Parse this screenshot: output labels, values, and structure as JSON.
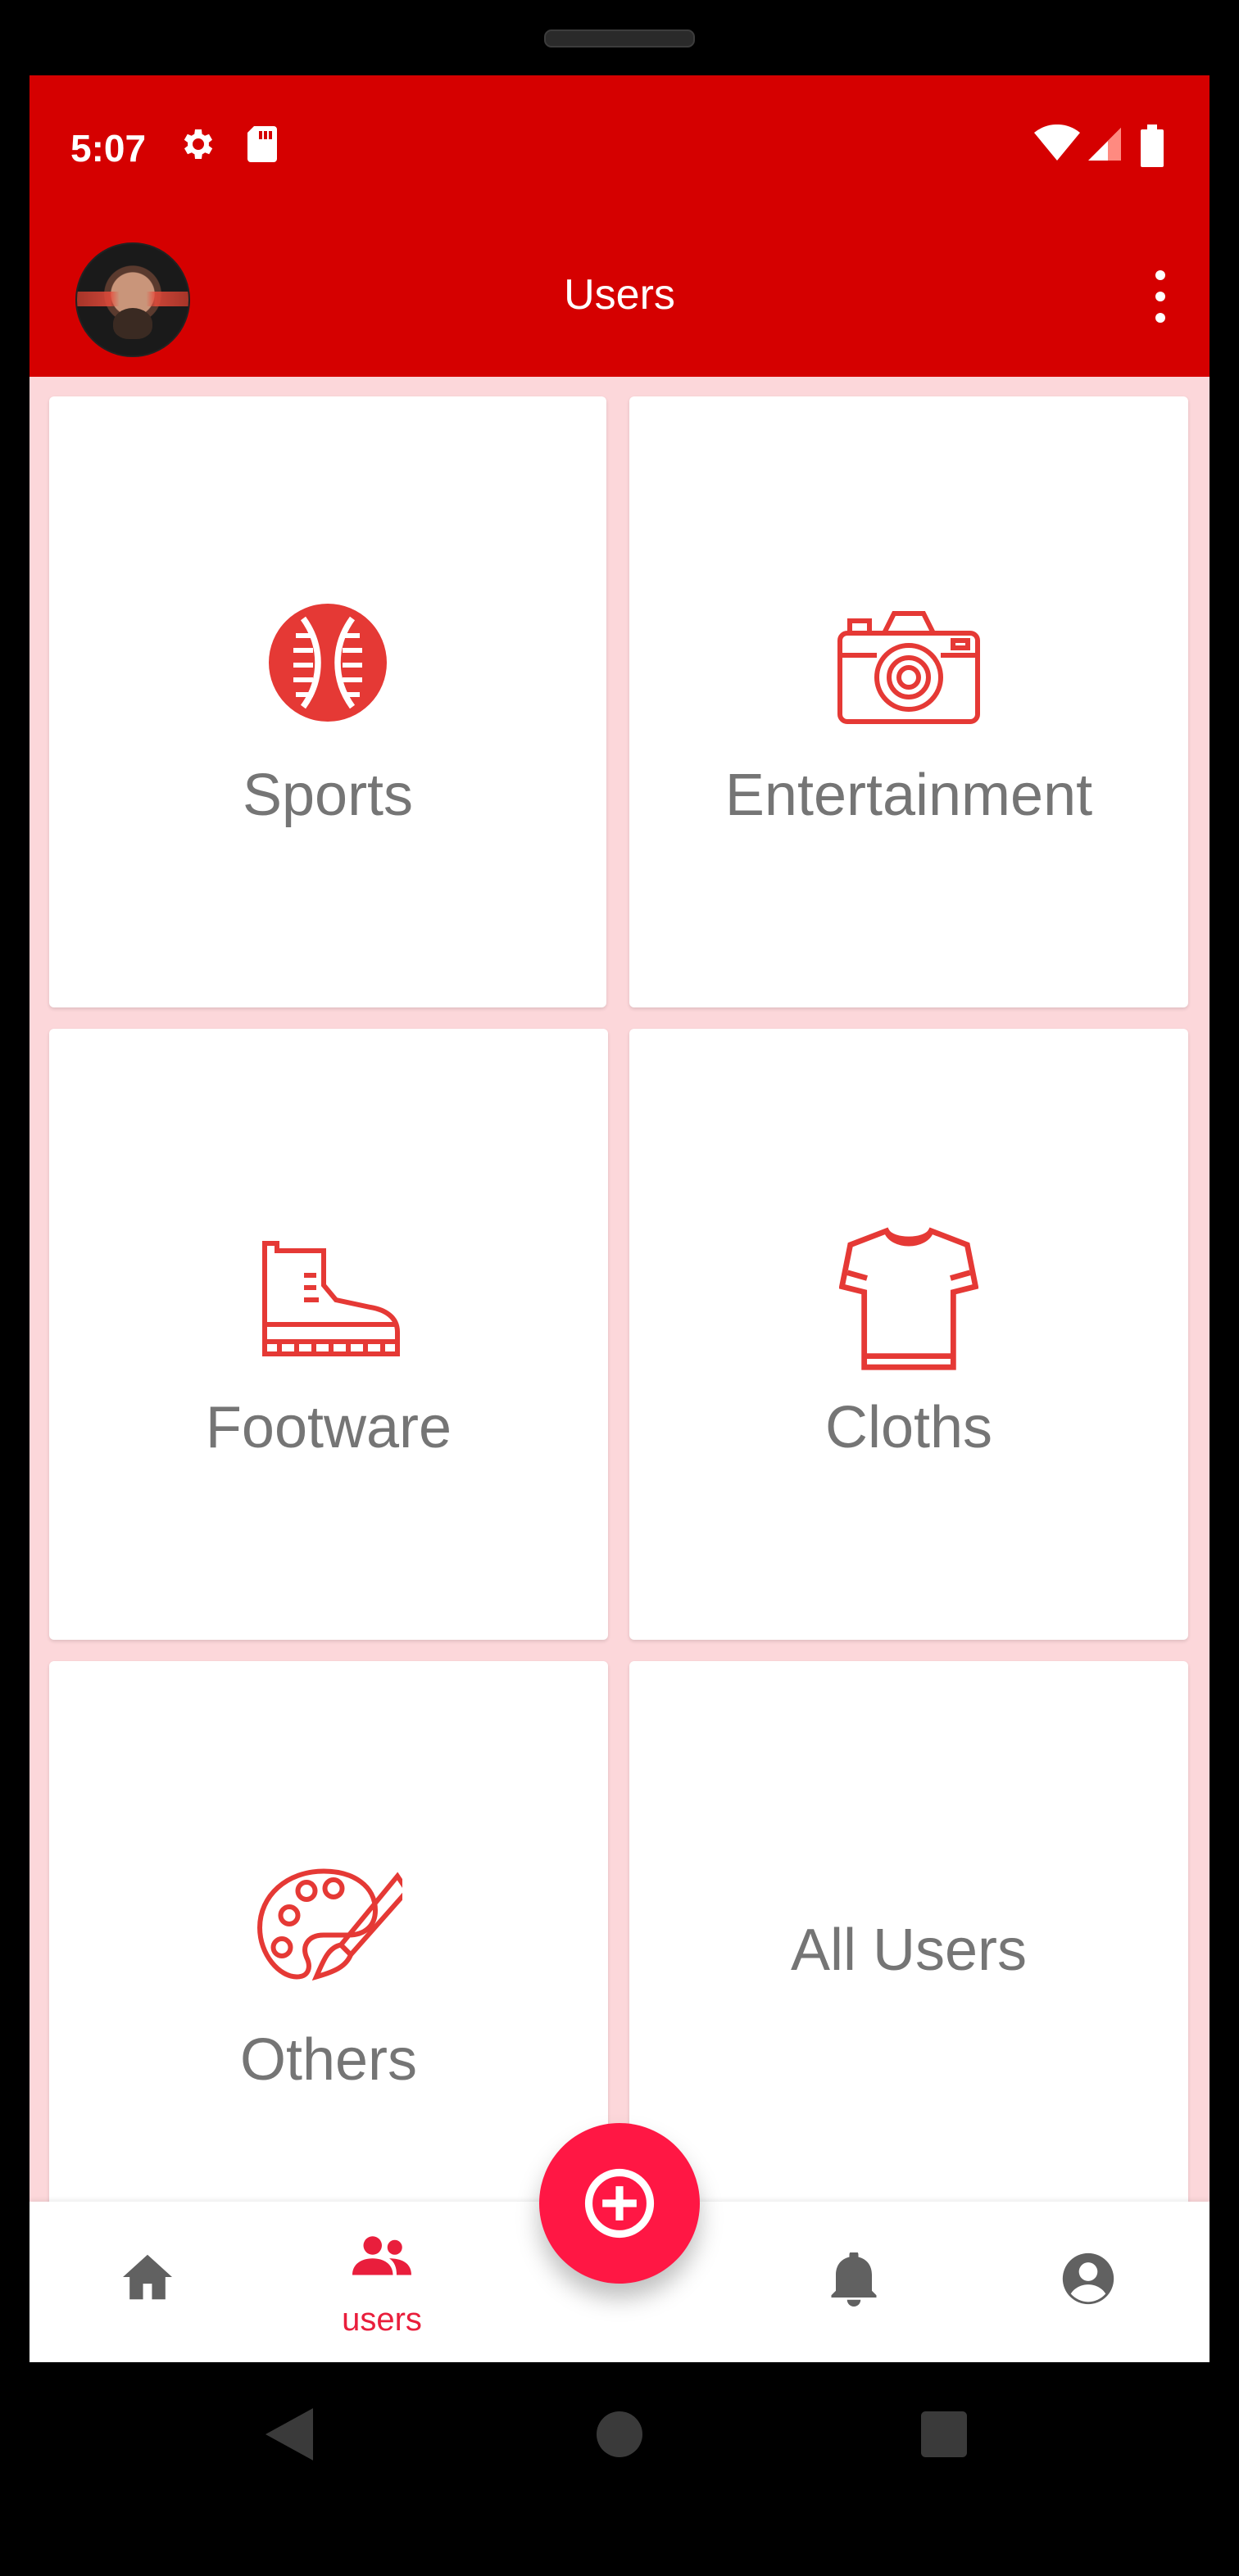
{
  "status_bar": {
    "time": "5:07",
    "left_icons": [
      "gear-icon",
      "sd-card-icon"
    ],
    "right_icons": [
      "wifi-icon",
      "signal-icon",
      "battery-icon"
    ]
  },
  "app_bar": {
    "title": "Users",
    "avatar": "profile-avatar",
    "menu_icon": "more-vert-icon",
    "color": "#d50000"
  },
  "categories": [
    {
      "label": "Sports",
      "icon": "baseball-icon"
    },
    {
      "label": "Entertainment",
      "icon": "camera-icon"
    },
    {
      "label": "Footware",
      "icon": "boot-icon"
    },
    {
      "label": "Cloths",
      "icon": "tshirt-icon"
    },
    {
      "label": "Others",
      "icon": "palette-icon"
    },
    {
      "label": "All Users",
      "icon": ""
    }
  ],
  "bottom_nav": {
    "items": [
      {
        "icon": "home-icon",
        "label": ""
      },
      {
        "icon": "users-icon",
        "label": "users",
        "active": true
      },
      {
        "icon": "bell-icon",
        "label": ""
      },
      {
        "icon": "account-circle-icon",
        "label": ""
      }
    ],
    "fab_icon": "add-circle-icon",
    "active_color": "#e91e3c",
    "fab_color": "#ff1744"
  },
  "system_nav": [
    "back-icon",
    "home-circle-icon",
    "recents-icon"
  ],
  "colors": {
    "accent": "#d50000",
    "background": "#fcd7da",
    "icon_red": "#e53935",
    "label_gray": "#757575"
  }
}
